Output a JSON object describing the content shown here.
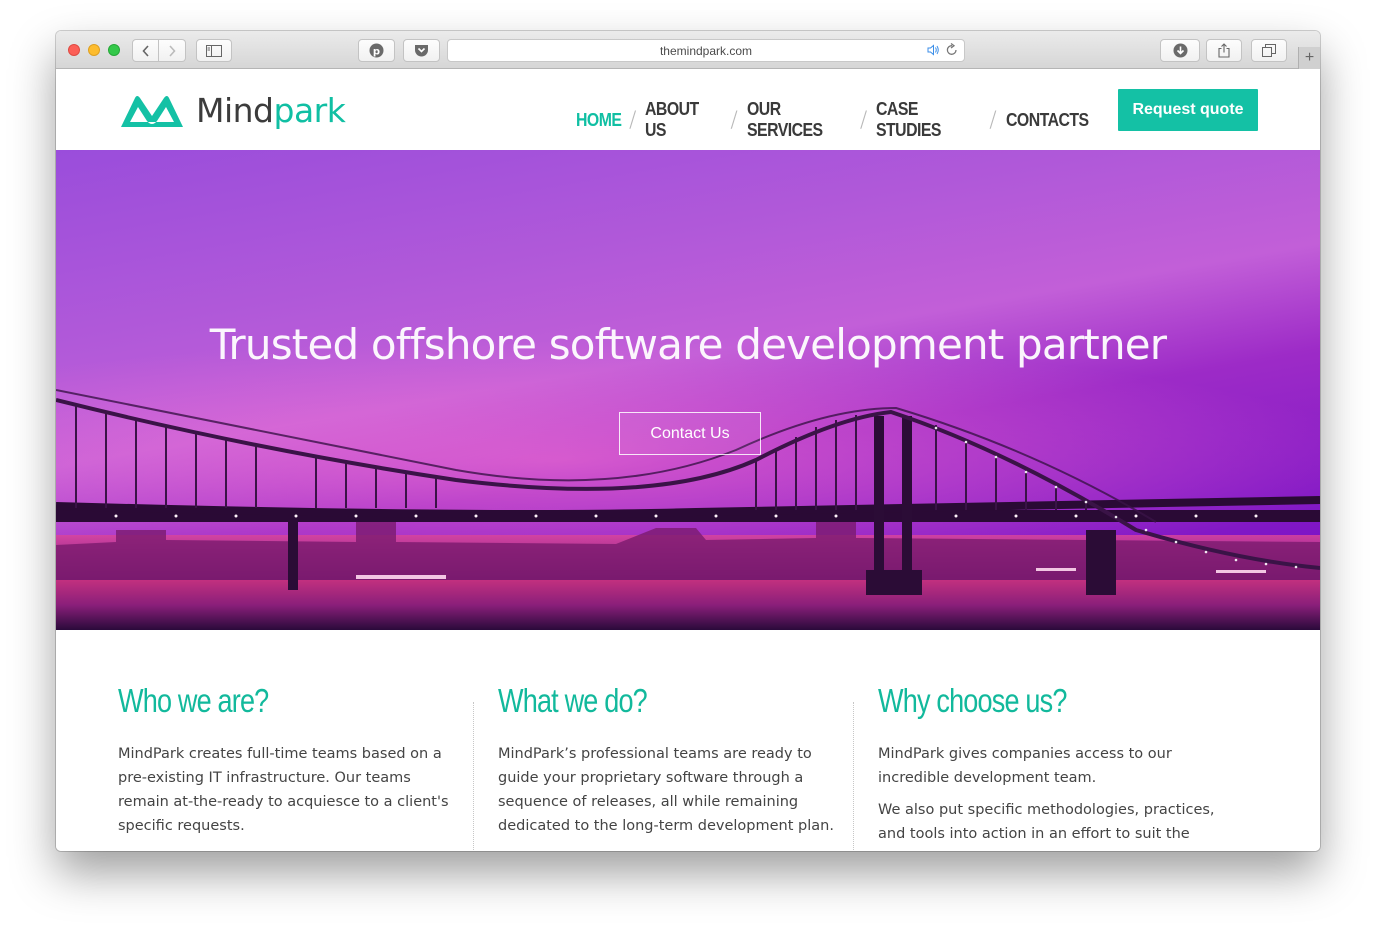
{
  "browser": {
    "url": "themindpark.com",
    "icons": [
      "back-icon",
      "forward-icon",
      "sidebar-icon",
      "pinterest-icon",
      "pocket-icon",
      "audio-icon",
      "reload-icon",
      "download-icon",
      "share-icon",
      "tabs-icon",
      "new-tab-icon"
    ]
  },
  "header": {
    "logo_prefix": "Mind",
    "logo_suffix": "park",
    "nav": [
      "HOME",
      "ABOUT US",
      "OUR SERVICES",
      "CASE STUDIES",
      "CONTACTS"
    ],
    "nav_active": "HOME",
    "separator": "/",
    "quote_button": "Request quote"
  },
  "hero": {
    "title": "Trusted offshore software development partner",
    "button": "Contact Us"
  },
  "features": [
    {
      "title": "Who we are?",
      "paragraphs": [
        "MindPark creates full-time teams based on a pre-existing IT infrastructure. Our teams remain at-the-ready to acquiesce to a client's specific requests."
      ]
    },
    {
      "title": "What we do?",
      "paragraphs": [
        "MindPark’s professional teams are ready to guide your proprietary software through a sequence of releases, all while remaining dedicated to the long-term development plan."
      ]
    },
    {
      "title": "Why choose us?",
      "paragraphs": [
        "MindPark gives companies access to our incredible development team.",
        "We also put specific methodologies, practices, and tools into action in an effort to suit the demand for"
      ]
    }
  ],
  "colors": {
    "accent": "#14c1a5",
    "nav_text": "#3a3a3a",
    "hero_top": "#9a4ddb",
    "hero_bottom": "#6e0ac5"
  }
}
